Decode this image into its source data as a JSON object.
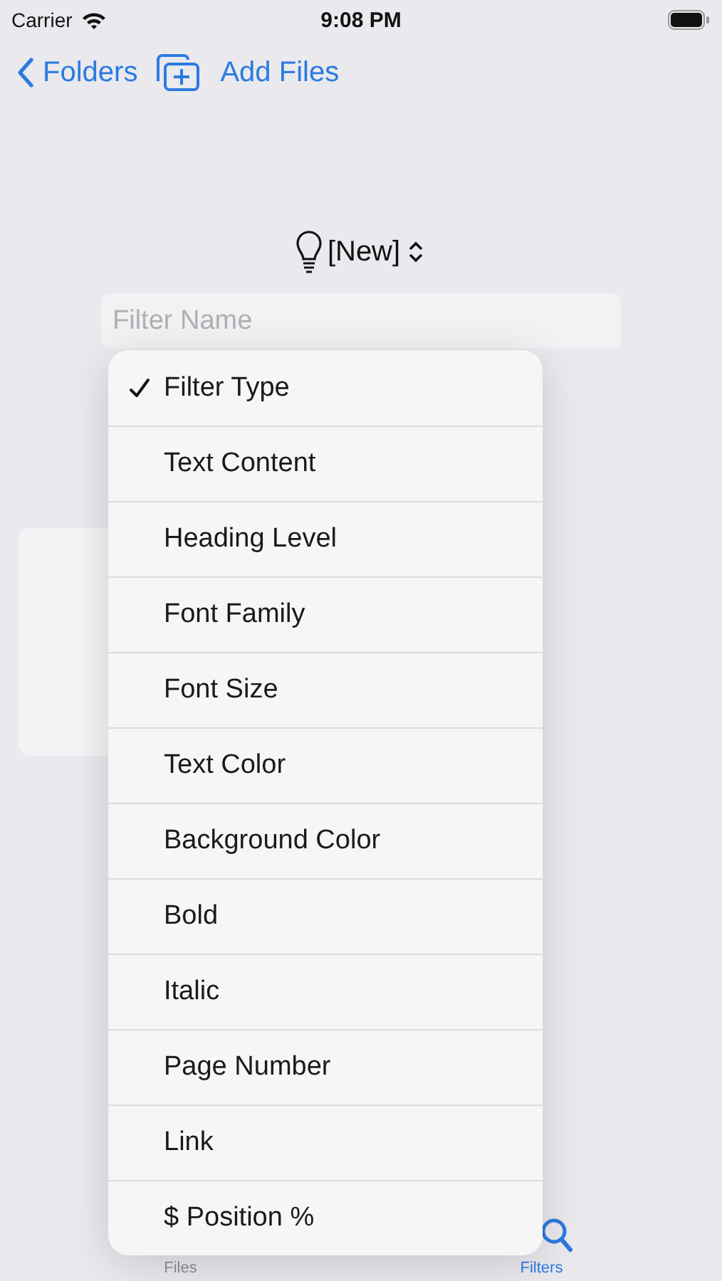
{
  "status_bar": {
    "carrier": "Carrier",
    "time": "9:08 PM"
  },
  "nav_bar": {
    "back": "Folders",
    "add": "Add Files"
  },
  "filter": {
    "title": "[New]",
    "name_field": {
      "placeholder": "Filter Name"
    }
  },
  "menu": {
    "items": [
      {
        "label": "Filter Type",
        "selected": true
      },
      {
        "label": "Text Content",
        "selected": false
      },
      {
        "label": "Heading Level",
        "selected": false
      },
      {
        "label": "Font Family",
        "selected": false
      },
      {
        "label": "Font Size",
        "selected": false
      },
      {
        "label": "Text Color",
        "selected": false
      },
      {
        "label": "Background Color",
        "selected": false
      },
      {
        "label": "Bold",
        "selected": false
      },
      {
        "label": "Italic",
        "selected": false
      },
      {
        "label": "Page Number",
        "selected": false
      },
      {
        "label": "Link",
        "selected": false
      },
      {
        "label": "$ Position %",
        "selected": false
      }
    ]
  },
  "tab_bar": [
    {
      "label": "Files",
      "selected": false
    },
    {
      "label": "Filters",
      "selected": true
    }
  ]
}
